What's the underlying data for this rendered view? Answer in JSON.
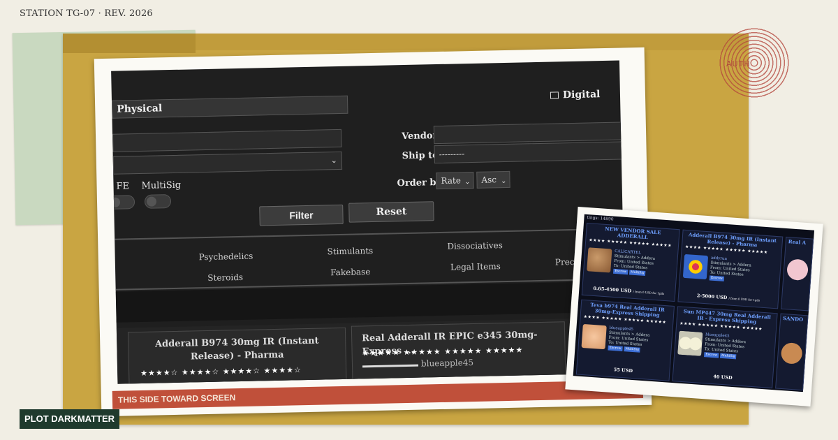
{
  "header": {
    "station": "STATION TG-07  ·  REV. 2026"
  },
  "stamp": {
    "text": "AUTH"
  },
  "ribbon": {
    "text": "THIS SIDE TOWARD SCREEN"
  },
  "plot_tag": {
    "text": "PLOT DARKMATTER"
  },
  "screen": {
    "tab_physical": "Physical",
    "tab_digital": "Digital",
    "vendor_label": "Vendor",
    "shipto_label": "Ship to",
    "shipto_value": "---------",
    "fe_label": "FE",
    "multisig_label": "MultiSig",
    "orderby_label": "Order by",
    "orderby_value": "Rate",
    "order_dir": "Asc",
    "filter_button": "Filter",
    "reset_button": "Reset",
    "categories": [
      "Psychedelics",
      "Stimulants",
      "Dissociatives",
      "Steroids",
      "Fakebase",
      "Legal Items",
      "Preci"
    ],
    "cards": [
      {
        "title": "Adderall B974 30mg IR (Instant Release) - Pharma",
        "stars": "★★★★☆  ★★★★☆  ★★★★☆  ★★★★☆"
      },
      {
        "title": "Real Adderall IR EPIC e345 30mg- Express ...",
        "stars": "★★★★★  ★★★★★  ★★★★★  ★★★★★",
        "vendor": "blueapple45"
      }
    ]
  },
  "small_photo": {
    "listings": "tings: 14890",
    "cards": [
      {
        "title": "NEW VENDOR SALE ADDERALL",
        "stars": "★★★★ ★★★★★ ★★★★★ ★★★★★",
        "vendor": "CALICARTEL",
        "cat": "Stimulants > Addera",
        "from": "From: United States",
        "to": "To: United States",
        "badges": [
          "Escrow",
          "MultiSig"
        ],
        "price": "0.65-4500 USD",
        "price_note": "/ from 0 USD for 1pils"
      },
      {
        "title": "Adderall B974 30mg IR (Instant Release) - Pharma",
        "stars": "★★★★ ★★★★★ ★★★★★ ★★★★★",
        "vendor": "addyrun",
        "cat": "Stimulants > Addera",
        "from": "From: United States",
        "to": "To: United States",
        "badges": [
          "Escrow"
        ],
        "price": "2-5000 USD",
        "price_note": "/ from 0 USD for 1pils"
      },
      {
        "title": "Teva b974 Real Adderall IR 30mg-Express Shipping",
        "stars": "★★★★ ★★★★★ ★★★★★ ★★★★★",
        "vendor": "blueapple45",
        "cat": "Stimulants > Addera",
        "from": "From: United States",
        "to": "To: United States",
        "badges": [
          "Escrow",
          "MultiSig"
        ],
        "price": "55 USD",
        "price_note": ""
      },
      {
        "title": "Sun MP447 30mg Real Adderall IR - Express Shipping",
        "stars": "★★★★ ★★★★★ ★★★★★ ★★★★★",
        "vendor": "blueapple45",
        "cat": "Stimulants > Addera",
        "from": "From: United States",
        "to": "To: United States",
        "badges": [
          "Escrow",
          "MultiSig"
        ],
        "price": "40 USD",
        "price_note": ""
      }
    ],
    "edge_labels": [
      "Real A",
      "SANDO"
    ]
  }
}
